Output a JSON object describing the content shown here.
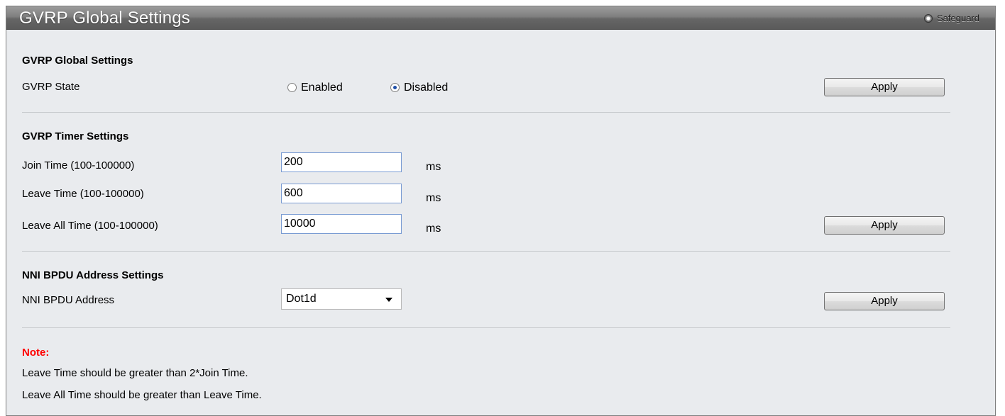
{
  "window": {
    "title": "GVRP Global Settings",
    "safeguard_label": "Safeguard"
  },
  "global": {
    "section_title": "GVRP Global Settings",
    "state_label": "GVRP State",
    "options": [
      {
        "label": "Enabled",
        "selected": false
      },
      {
        "label": "Disabled",
        "selected": true
      }
    ],
    "apply_label": "Apply"
  },
  "timer": {
    "section_title": "GVRP Timer Settings",
    "join_label": "Join Time (100-100000)",
    "join_value": "200",
    "leave_label": "Leave Time (100-100000)",
    "leave_value": "600",
    "leave_all_label": "Leave All Time (100-100000)",
    "leave_all_value": "10000",
    "unit": "ms",
    "apply_label": "Apply"
  },
  "nni": {
    "section_title": "NNI BPDU Address Settings",
    "address_label": "NNI BPDU Address",
    "selected": "Dot1d",
    "apply_label": "Apply"
  },
  "note": {
    "title": "Note:",
    "lines": [
      "Leave Time should be greater than 2*Join Time.",
      "Leave All Time should be greater than Leave Time."
    ]
  },
  "colors": {
    "note_title": "#ff0000",
    "radio_selected": "#1f4fa8",
    "title_text": "#ffffff"
  }
}
